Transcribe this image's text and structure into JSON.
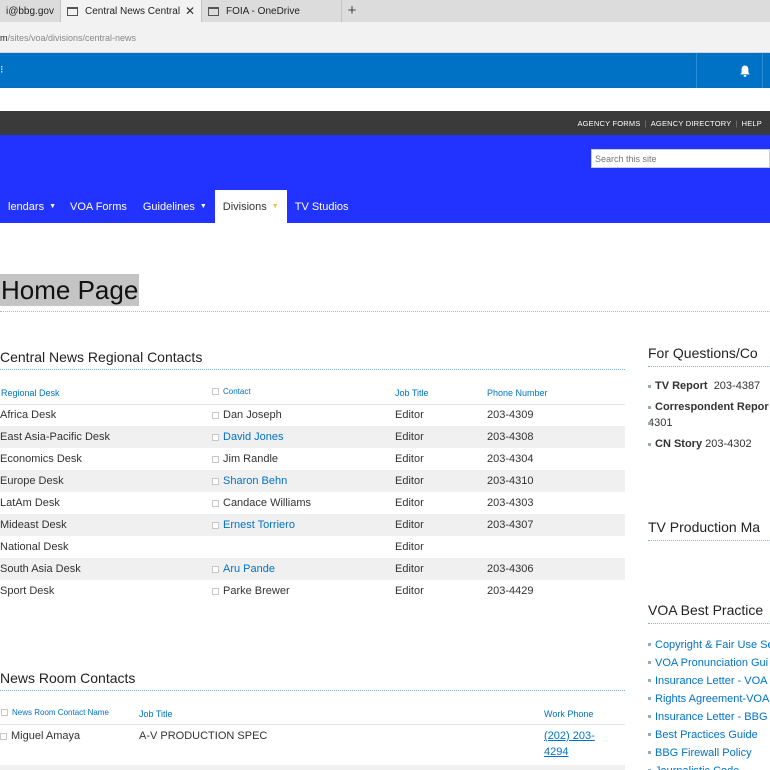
{
  "browser": {
    "tabs": [
      {
        "label": "i@bbg.gov"
      },
      {
        "label": "Central News Central N",
        "close": "✕"
      },
      {
        "label": "FOIA - OneDrive"
      }
    ],
    "new_tab": "+",
    "url_host_tail": "m",
    "url_path": "/sites/voa/divisions/central-news"
  },
  "suitebar": {
    "left_glyph": "⁝"
  },
  "topbar": {
    "links": [
      "AGENCY FORMS",
      "AGENCY DIRECTORY",
      "HELP"
    ]
  },
  "header": {
    "search_placeholder": "Search this site",
    "nav": [
      {
        "label": "lendars",
        "caret": "▼"
      },
      {
        "label": "VOA Forms",
        "caret": ""
      },
      {
        "label": "Guidelines",
        "caret": "▼"
      },
      {
        "label": "Divisions",
        "caret": "▼"
      },
      {
        "label": "TV Studios",
        "caret": ""
      }
    ]
  },
  "page": {
    "title": "Home Page"
  },
  "regional": {
    "title": "Central News Regional Contacts",
    "columns": [
      "Regional Desk",
      "Contact",
      "Job Title",
      "Phone Number"
    ],
    "rows": [
      {
        "desk": "Africa Desk",
        "contact": "Dan Joseph",
        "link": false,
        "job": "Editor",
        "phone": "203-4309"
      },
      {
        "desk": "East Asia-Pacific Desk",
        "contact": "David Jones",
        "link": true,
        "job": "Editor",
        "phone": "203-4308"
      },
      {
        "desk": "Economics Desk",
        "contact": "Jim Randle",
        "link": false,
        "job": "Editor",
        "phone": "203-4304"
      },
      {
        "desk": "Europe Desk",
        "contact": "Sharon Behn",
        "link": true,
        "job": "Editor",
        "phone": "203-4310"
      },
      {
        "desk": "LatAm Desk",
        "contact": "Candace Williams",
        "link": false,
        "job": "Editor",
        "phone": "203-4303"
      },
      {
        "desk": "Mideast Desk",
        "contact": "Ernest Torriero",
        "link": true,
        "job": "Editor",
        "phone": "203-4307"
      },
      {
        "desk": "National Desk",
        "contact": "",
        "link": false,
        "job": "Editor",
        "phone": ""
      },
      {
        "desk": "South Asia Desk",
        "contact": "Aru Pande",
        "link": true,
        "job": "Editor",
        "phone": "203-4306"
      },
      {
        "desk": "Sport Desk",
        "contact": "Parke Brewer",
        "link": false,
        "job": "Editor",
        "phone": "203-4429"
      }
    ]
  },
  "newsroom": {
    "title": "News Room Contacts",
    "columns": [
      "News Room Contact Name",
      "Job Title",
      "Work Phone"
    ],
    "rows": [
      {
        "name": "Miguel Amaya",
        "job": "A-V PRODUCTION SPEC",
        "phone_line1": "(202) 203-",
        "phone_line2": "4294"
      }
    ]
  },
  "right": {
    "questions": {
      "title": "For Questions/Co",
      "items": [
        {
          "label": "TV Report",
          "value": "203-4387"
        },
        {
          "label": "Correspondent Repor",
          "value": "4301"
        },
        {
          "label": "CN Story",
          "value": "203-4302"
        }
      ]
    },
    "tv_production": {
      "title": "TV Production Ma"
    },
    "best_practices": {
      "title": "VOA Best Practice",
      "links": [
        "Copyright & Fair Use Se",
        "VOA Pronunciation Gui",
        "Insurance Letter - VOA",
        "Rights Agreement-VOA",
        "Insurance Letter - BBG",
        "Best Practices Guide",
        "BBG Firewall Policy",
        "Journalistic Code"
      ]
    }
  }
}
